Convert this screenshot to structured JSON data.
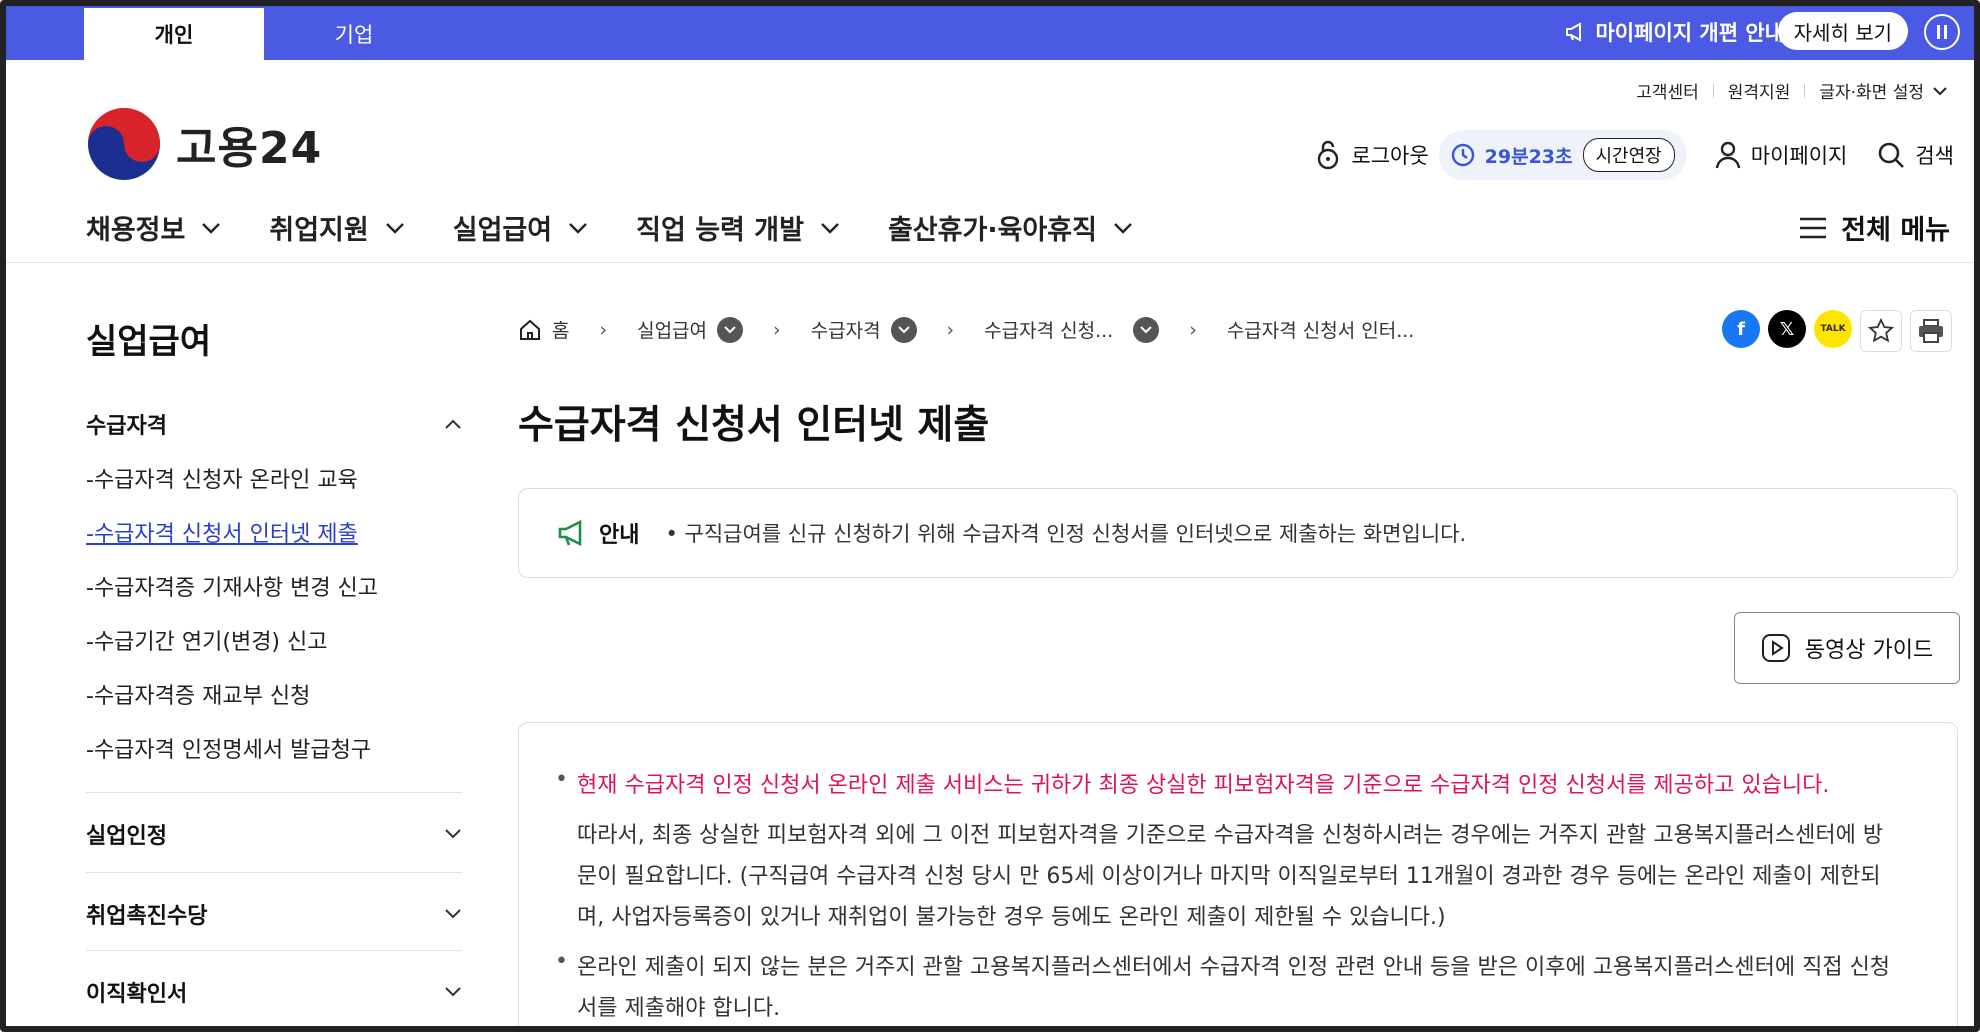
{
  "topbar": {
    "tabs": [
      "개인",
      "기업"
    ],
    "notice": "마이페이지 개편 안내",
    "detail_button": "자세히 보기"
  },
  "util_links": [
    "고객센터",
    "원격지원",
    "글자·화면 설정"
  ],
  "logo": {
    "text": "고용24"
  },
  "header": {
    "logout": "로그아웃",
    "timer": "29분23초",
    "extend": "시간연장",
    "mypage": "마이페이지",
    "search": "검색"
  },
  "gnb": {
    "items": [
      "채용정보",
      "취업지원",
      "실업급여",
      "직업 능력 개발",
      "출산휴가·육아휴직"
    ],
    "all_menu": "전체 메뉴"
  },
  "sidebar": {
    "title": "실업급여",
    "sections": [
      {
        "label": "수급자격",
        "expanded": true,
        "items": [
          "-수급자격 신청자 온라인 교육",
          "-수급자격 신청서 인터넷 제출",
          "-수급자격증 기재사항 변경 신고",
          "-수급기간 연기(변경) 신고",
          "-수급자격증 재교부 신청",
          "-수급자격 인정명세서 발급청구"
        ],
        "active_index": 1
      },
      {
        "label": "실업인정"
      },
      {
        "label": "취업촉진수당"
      },
      {
        "label": "이직확인서"
      }
    ]
  },
  "breadcrumb": [
    "홈",
    "실업급여",
    "수급자격",
    "수급자격 신청...",
    "수급자격 신청서 인터..."
  ],
  "share_icons": [
    "facebook-icon",
    "x-icon",
    "kakaotalk-icon",
    "star-icon",
    "print-icon"
  ],
  "kakao_label": "TALK",
  "page_title": "수급자격 신청서 인터넷 제출",
  "info": {
    "label": "안내",
    "text": "• 구직급여를 신규 신청하기 위해 수급자격 인정 신청서를 인터넷으로 제출하는 화면입니다."
  },
  "video_guide": "동영상 가이드",
  "content": {
    "p1": "현재 수급자격 인정 신청서 온라인 제출 서비스는 귀하가 최종 상실한 피보험자격을 기준으로 수급자격 인정 신청서를 제공하고 있습니다.",
    "p2_l1": "따라서, 최종 상실한 피보험자격 외에 그 이전 피보험자격을 기준으로 수급자격을 신청하시려는 경우에는 거주지 관할 고용복지플러스센터에 방",
    "p2_l2": "문이 필요합니다. (구직급여 수급자격 신청 당시 만 65세 이상이거나 마지막 이직일로부터 11개월이 경과한 경우 등에는 온라인 제출이 제한되",
    "p2_l3": "며, 사업자등록증이 있거나 재취업이 불가능한 경우 등에도 온라인 제출이 제한될 수 있습니다.)",
    "p3_l1": "온라인 제출이 되지 않는 분은 거주지 관할 고용복지플러스센터에서 수급자격 인정 관련 안내 등을 받은 이후에 고용복지플러스센터에 직접 신청",
    "p3_l2": "서를 제출해야 합니다."
  },
  "colors": {
    "topbar": "#4a5ae3",
    "accent_blue": "#3b55d6",
    "warning": "#e0115f"
  }
}
